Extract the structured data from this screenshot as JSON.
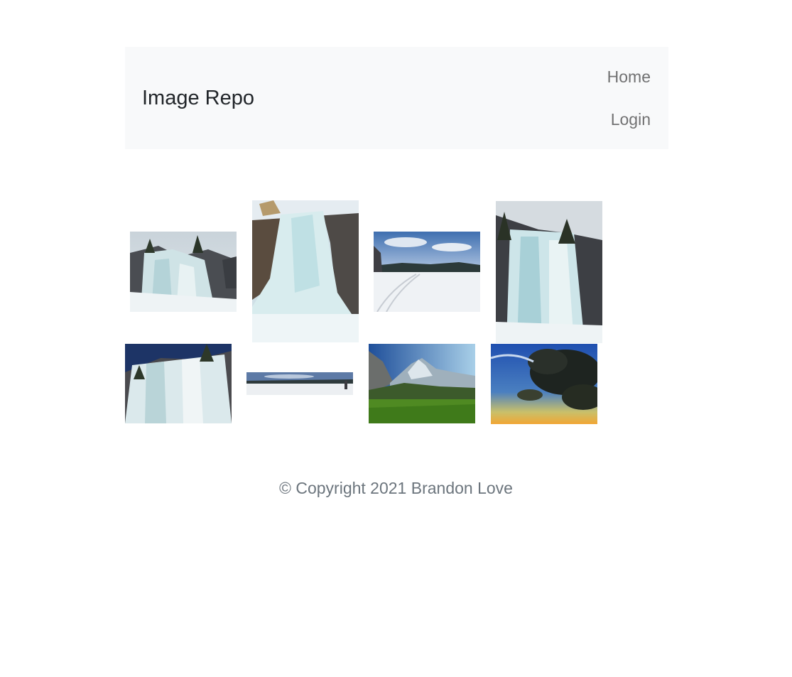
{
  "navbar": {
    "brand": "Image Repo",
    "links": [
      {
        "label": "Home"
      },
      {
        "label": "Login"
      }
    ]
  },
  "gallery": {
    "images": [
      {
        "subject": "frozen waterfall with trees"
      },
      {
        "subject": "frozen waterfall"
      },
      {
        "subject": "snowy frozen lake"
      },
      {
        "subject": "icicle cliff with trees"
      },
      {
        "subject": "ice wall under blue sky"
      },
      {
        "subject": "frozen lake panorama"
      },
      {
        "subject": "mountains and green meadow"
      },
      {
        "subject": "dark storm clouds at sunset"
      }
    ]
  },
  "footer": {
    "copyright": "© Copyright 2021 Brandon Love"
  },
  "colors": {
    "navbar_bg": "#f8f9fa",
    "brand_text": "#212529",
    "nav_text": "#7a7b7c",
    "footer_text": "#6c757d"
  }
}
